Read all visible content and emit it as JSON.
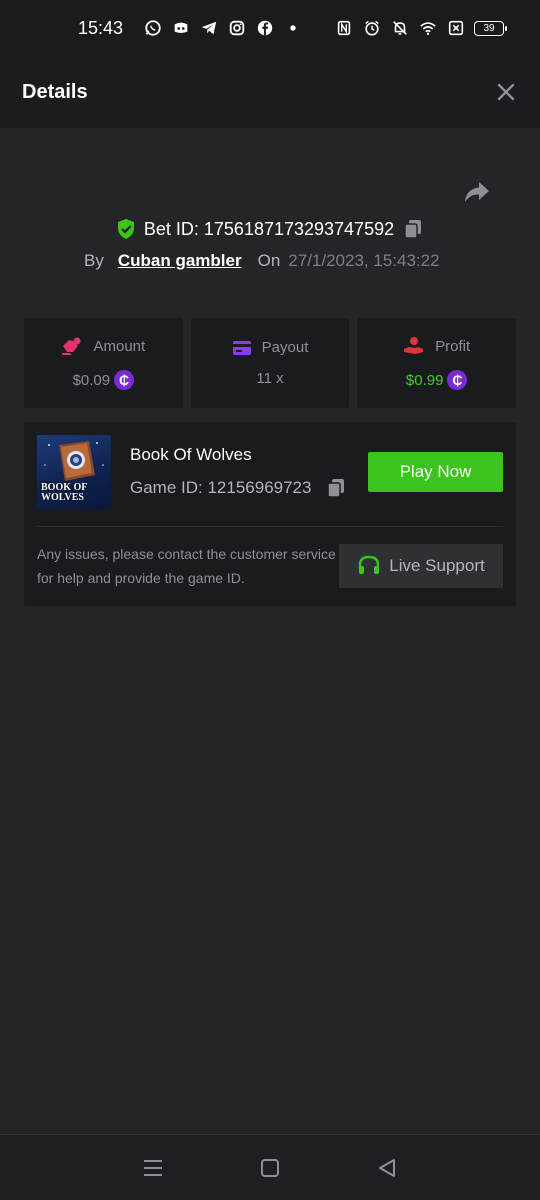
{
  "status_bar": {
    "time": "15:43",
    "battery": "39",
    "icons_left": [
      "whatsapp-icon",
      "discord-icon",
      "telegram-icon",
      "instagram-icon",
      "facebook-icon",
      "dot-icon"
    ],
    "icons_right": [
      "nfc-icon",
      "alarm-icon",
      "bell-off-icon",
      "wifi-icon",
      "sim-off-icon",
      "battery-icon"
    ]
  },
  "header": {
    "title": "Details"
  },
  "bet": {
    "id_text": "Bet ID: 1756187173293747592",
    "by_label": "By",
    "user": "Cuban gambler",
    "on_label": "On",
    "date": "27/1/2023, 15:43:22"
  },
  "stats": {
    "amount": {
      "label": "Amount",
      "value": "$0.09"
    },
    "payout": {
      "label": "Payout",
      "value": "11 x"
    },
    "profit": {
      "label": "Profit",
      "value": "$0.99"
    },
    "coin_symbol": "₵"
  },
  "game": {
    "name": "Book Of Wolves",
    "id_text": "Game ID: 12156969723",
    "thumb_line1": "BOOK OF",
    "thumb_line2": "WOLVES",
    "play_label": "Play Now",
    "support_text": "Any issues, please contact the customer service for help and provide the game ID.",
    "support_label": "Live Support"
  },
  "colors": {
    "background": "#232529",
    "card": "#1a1b1e",
    "accent_green": "#3cc31d",
    "profit_green": "#3dd123",
    "coin_purple": "#7a2bd6",
    "amount_icon": "#e4326f",
    "payout_icon": "#8a3df0",
    "profit_icon": "#e0343a"
  }
}
